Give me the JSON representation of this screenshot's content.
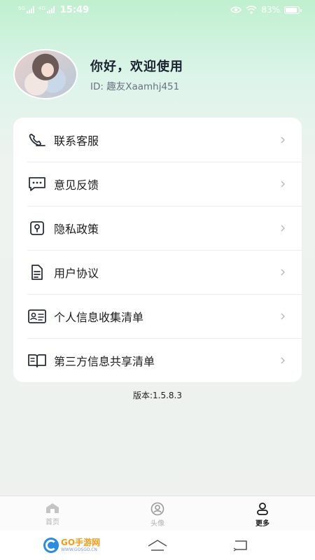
{
  "status_bar": {
    "signal_tags": [
      "5G",
      "4G"
    ],
    "time": "15:49",
    "battery": "83%",
    "icons": [
      "eye-icon",
      "wifi-icon",
      "battery-icon"
    ]
  },
  "profile": {
    "greeting": "你好，欢迎使用",
    "id_text": "ID: 趣友Xaamhj451"
  },
  "menu": {
    "items": [
      {
        "label": "联系客服",
        "icon": "customer-service-icon"
      },
      {
        "label": "意见反馈",
        "icon": "feedback-icon"
      },
      {
        "label": "隐私政策",
        "icon": "privacy-icon"
      },
      {
        "label": "用户协议",
        "icon": "document-icon"
      },
      {
        "label": "个人信息收集清单",
        "icon": "id-card-icon"
      },
      {
        "label": "第三方信息共享清单",
        "icon": "book-icon"
      }
    ]
  },
  "version": "版本:1.5.8.3",
  "tabbar": {
    "tabs": [
      {
        "label": "首页",
        "icon": "home-icon",
        "active": false
      },
      {
        "label": "头像",
        "icon": "avatar-icon",
        "active": false
      },
      {
        "label": "更多",
        "icon": "user-icon",
        "active": true
      }
    ]
  },
  "watermark": {
    "main": "GO手游网",
    "main_prefix": "GO",
    "main_suffix": "手游网",
    "sub": "WWW.GOSGO.CN"
  },
  "colors": {
    "accent_gradient_top": "#bff0cf",
    "background": "#eef1ee",
    "card": "#ffffff",
    "text_primary": "#1c1c1e",
    "text_secondary": "#6a7180"
  }
}
